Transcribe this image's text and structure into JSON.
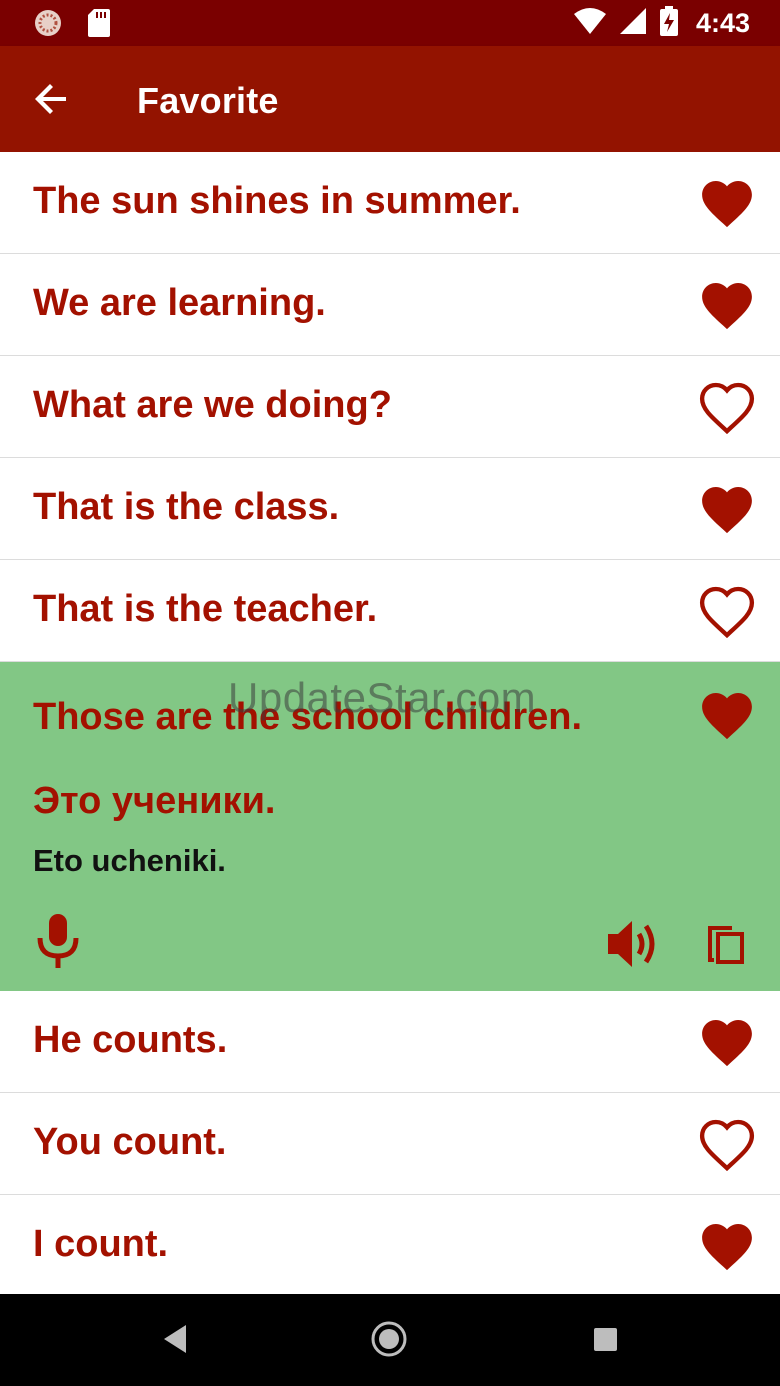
{
  "status_bar": {
    "time": "4:43"
  },
  "app_bar": {
    "title": "Favorite"
  },
  "phrases_top": [
    {
      "text": "The sun shines in summer.",
      "favorite": true
    },
    {
      "text": "We are learning.",
      "favorite": true
    },
    {
      "text": "What are we doing?",
      "favorite": false
    },
    {
      "text": "That is the class.",
      "favorite": true
    },
    {
      "text": "That is the teacher.",
      "favorite": false
    }
  ],
  "expanded_phrase": {
    "text": "Those are the school children.",
    "favorite": true,
    "translation": "Это ученики.",
    "transliteration": "Eto ucheniki."
  },
  "phrases_bottom": [
    {
      "text": "He counts.",
      "favorite": true
    },
    {
      "text": "You count.",
      "favorite": false
    },
    {
      "text": "I count.",
      "favorite": true
    }
  ],
  "watermark": "UpdateStar.com",
  "colors": {
    "status_bar": "#7a0000",
    "app_bar": "#931300",
    "accent_text": "#a31100",
    "expanded_bg": "#82c785"
  },
  "icons": {
    "back": "arrow-back-icon",
    "favorite_on": "heart-filled-icon",
    "favorite_off": "heart-outline-icon",
    "mic": "microphone-icon",
    "speaker": "speaker-icon",
    "copy": "copy-icon"
  }
}
